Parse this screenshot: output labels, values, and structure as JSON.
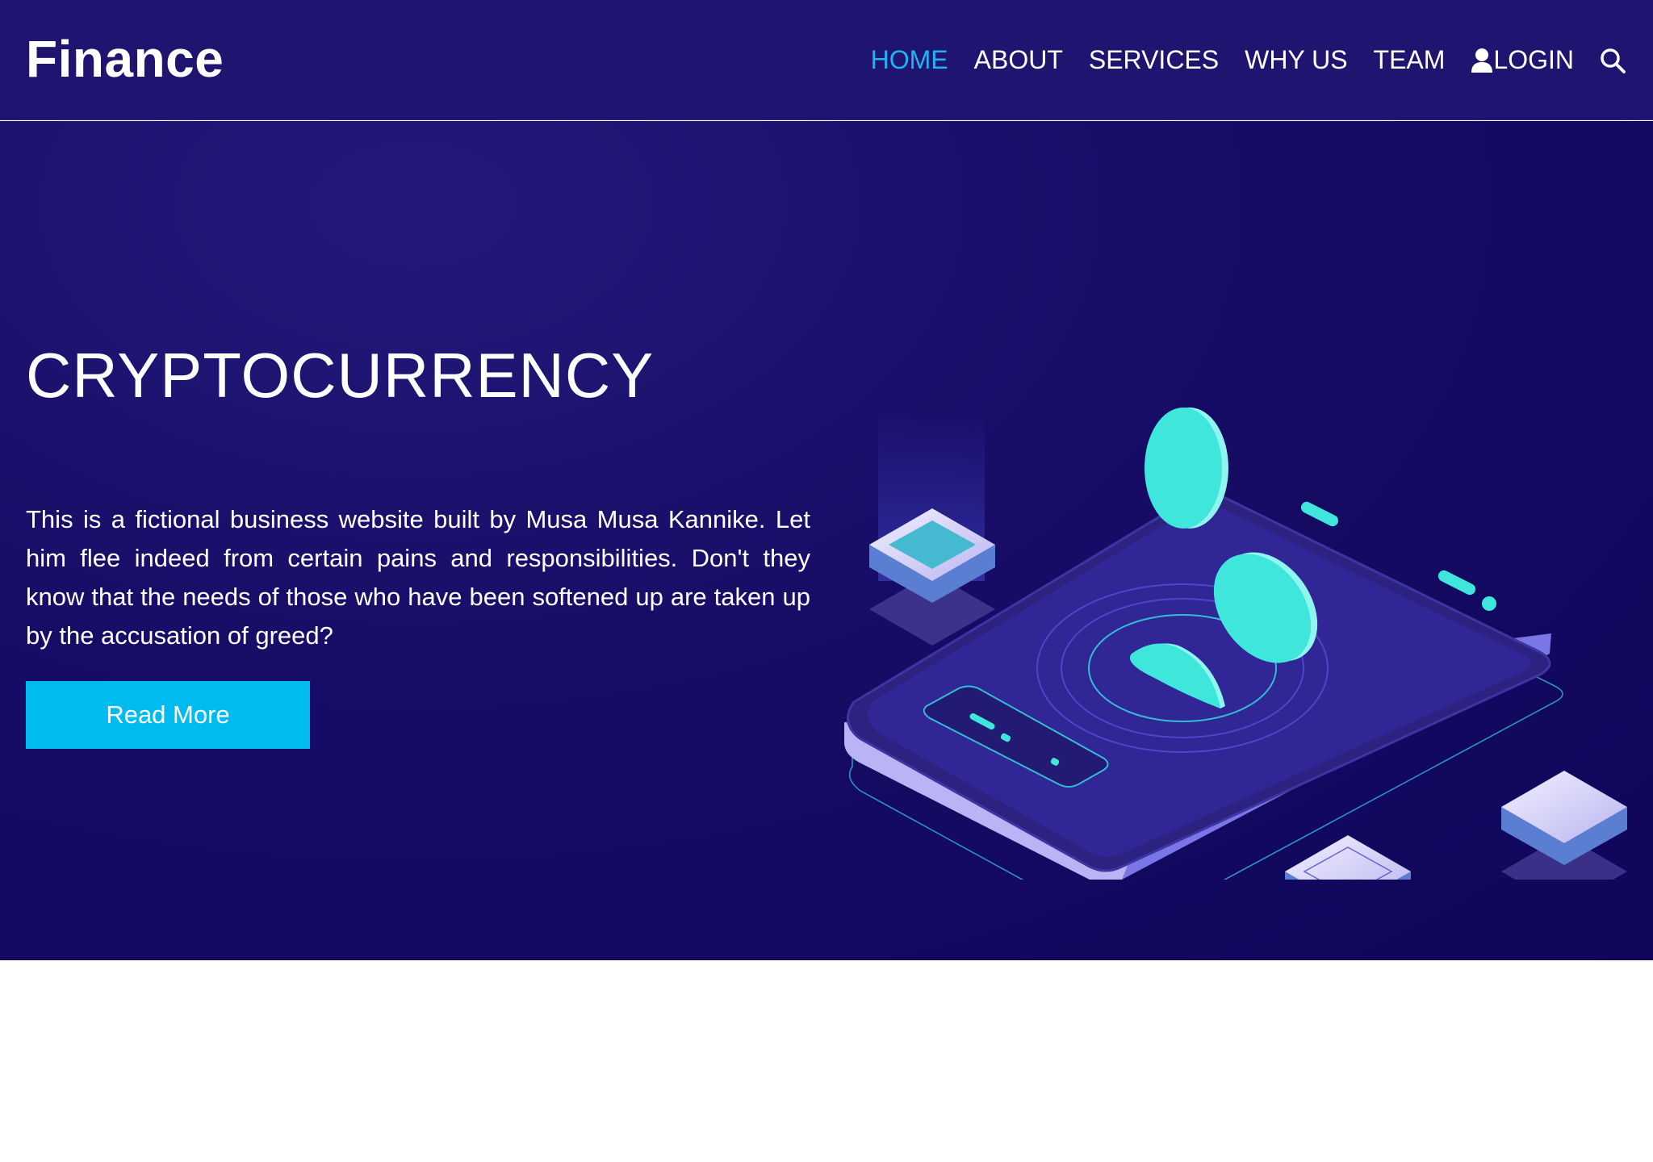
{
  "header": {
    "brand": "Finance",
    "nav": {
      "home": "HOME",
      "about": "ABOUT",
      "services": "SERVICES",
      "why_us": "WHY US",
      "team": "TEAM",
      "login": "LOGIN"
    },
    "icons": {
      "user": "user-icon",
      "search": "search-icon"
    }
  },
  "hero": {
    "title": "CRYPTOCURRENCY",
    "description": "This is a fictional business website built by Musa Musa Kannike. Let him flee indeed from certain pains and responsibilities. Don't they know that the needs of those who have been softened up are taken up by the accusation of greed?",
    "button_label": "Read More"
  },
  "colors": {
    "header_bg": "#1f1571",
    "hero_bg": "#150b63",
    "accent": "#00bbf0",
    "active_nav": "#1fb3f2",
    "teal": "#3ee6dc"
  }
}
